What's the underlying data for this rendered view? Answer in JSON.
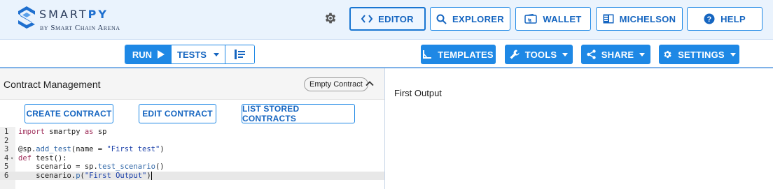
{
  "app": {
    "name_regular": "SMART",
    "name_bold": "PY",
    "byline": "by Smart Chain Arena"
  },
  "header_nav": {
    "editor": "EDITOR",
    "explorer": "EXPLORER",
    "wallet": "WALLET",
    "michelson": "MICHELSON",
    "help": "HELP"
  },
  "toolbar": {
    "run": "RUN",
    "tests": "TESTS",
    "templates": "TEMPLATES",
    "tools": "TOOLS",
    "share": "SHARE",
    "settings": "SETTINGS"
  },
  "contract_management": {
    "title": "Contract Management",
    "chip": "Empty Contract",
    "create": "CREATE CONTRACT",
    "edit": "EDIT CONTRACT",
    "list": "LIST STORED CONTRACTS"
  },
  "editor": {
    "line_numbers": [
      "1",
      "2",
      "3",
      "4",
      "5",
      "6"
    ],
    "lines": [
      [
        {
          "t": "import",
          "c": "kw"
        },
        {
          "t": " smartpy ",
          "c": ""
        },
        {
          "t": "as",
          "c": "kw"
        },
        {
          "t": " sp",
          "c": ""
        }
      ],
      [],
      [
        {
          "t": "@sp.",
          "c": ""
        },
        {
          "t": "add_test",
          "c": "fn"
        },
        {
          "t": "(name = ",
          "c": ""
        },
        {
          "t": "\"First test\"",
          "c": "str"
        },
        {
          "t": ")",
          "c": ""
        }
      ],
      [
        {
          "t": "def",
          "c": "kw"
        },
        {
          "t": " test():",
          "c": ""
        }
      ],
      [
        {
          "t": "    scenario = sp.",
          "c": ""
        },
        {
          "t": "test_scenario",
          "c": "fn"
        },
        {
          "t": "()",
          "c": ""
        }
      ],
      [
        {
          "t": "    scenario.",
          "c": ""
        },
        {
          "t": "p",
          "c": "fn"
        },
        {
          "t": "(",
          "c": ""
        },
        {
          "t": "\"First Output\"",
          "c": "str"
        },
        {
          "t": ")",
          "c": ""
        }
      ]
    ]
  },
  "output": {
    "text": "First Output"
  },
  "colors": {
    "accent": "#1e88e5",
    "header_bg": "#eaf3fd"
  },
  "icons": {
    "theme": "gear-icon",
    "editor": "code-icon",
    "explorer": "search-icon",
    "wallet": "wallet-icon",
    "michelson": "book-icon",
    "help": "help-icon",
    "run": "play-icon",
    "clear": "clear-all-icon",
    "templates": "angle-icon",
    "tools": "wrench-icon",
    "share": "share-icon",
    "settings": "settings-icon"
  }
}
